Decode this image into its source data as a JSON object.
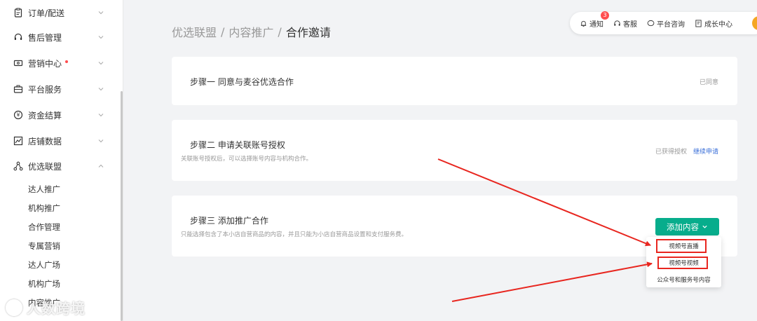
{
  "sidebar": {
    "items": [
      {
        "label": "订单/配送",
        "icon": "clipboard-icon"
      },
      {
        "label": "售后管理",
        "icon": "headset-icon"
      },
      {
        "label": "营销中心",
        "icon": "ticket-icon",
        "dot": true
      },
      {
        "label": "平台服务",
        "icon": "briefcase-icon"
      },
      {
        "label": "资金结算",
        "icon": "yen-icon"
      },
      {
        "label": "店铺数据",
        "icon": "chart-icon"
      },
      {
        "label": "优选联盟",
        "icon": "network-icon",
        "expanded": true
      }
    ],
    "sub_items": [
      "达人推广",
      "机构推广",
      "合作管理",
      "专属营销",
      "达人广场",
      "机构广场",
      "内容推广"
    ]
  },
  "breadcrumb": {
    "level1": "优选联盟",
    "sep1": "/",
    "level2": "内容推广",
    "sep2": "/",
    "current": "合作邀请"
  },
  "toolbar": {
    "notice_label": "通知",
    "notice_count": "3",
    "service_label": "客服",
    "consult_label": "平台咨询",
    "growth_label": "成长中心"
  },
  "steps": {
    "step1": {
      "title": "步骤一 同意与麦谷优选合作",
      "status": "已同意"
    },
    "step2": {
      "title": "步骤二 申请关联账号授权",
      "desc": "关联账号授权后，可以选择账号内容与机构合作。",
      "status": "已获得授权",
      "link": "继续申请"
    },
    "step3": {
      "title": "步骤三 添加推广合作",
      "desc": "只能选择包含了本小店自营商品的内容，并且只能为小店自营商品设置和支付服务费。",
      "button": "添加内容"
    }
  },
  "dropdown": {
    "options": [
      "视频号直播",
      "视频号视频",
      "公众号和服务号内容"
    ]
  },
  "watermark": "人数跨境",
  "colors": {
    "accent": "#07ad8c",
    "link": "#3a6fd8",
    "annotation": "#e8261f",
    "badge": "#ff4d4f"
  }
}
